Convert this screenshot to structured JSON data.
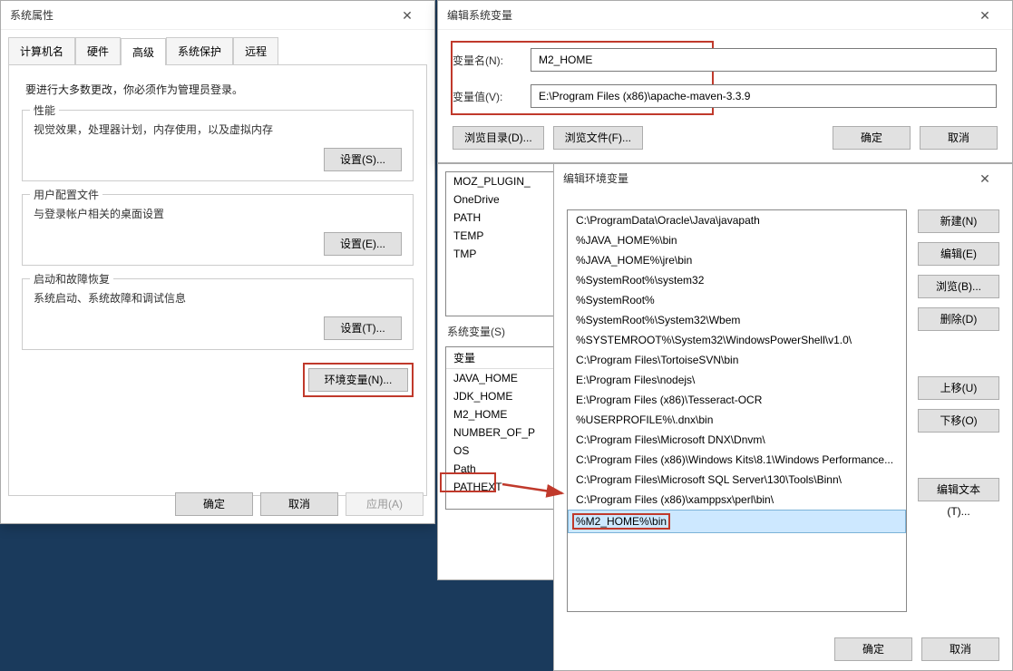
{
  "sysprops": {
    "title": "系统属性",
    "tabs": [
      "计算机名",
      "硬件",
      "高级",
      "系统保护",
      "远程"
    ],
    "active_tab_idx": 2,
    "notice": "要进行大多数更改，你必须作为管理员登录。",
    "group_perf": {
      "legend": "性能",
      "desc": "视觉效果，处理器计划，内存使用，以及虚拟内存",
      "btn": "设置(S)..."
    },
    "group_user": {
      "legend": "用户配置文件",
      "desc": "与登录帐户相关的桌面设置",
      "btn": "设置(E)..."
    },
    "group_start": {
      "legend": "启动和故障恢复",
      "desc": "系统启动、系统故障和调试信息",
      "btn": "设置(T)..."
    },
    "env_btn": "环境变量(N)...",
    "ok": "确定",
    "cancel": "取消",
    "apply": "应用(A)"
  },
  "editvar": {
    "title": "编辑系统变量",
    "name_label": "变量名(N):",
    "value_label": "变量值(V):",
    "name": "M2_HOME",
    "value": "E:\\Program Files (x86)\\apache-maven-3.3.9",
    "browse_dir": "浏览目录(D)...",
    "browse_file": "浏览文件(F)...",
    "ok": "确定",
    "cancel": "取消"
  },
  "envvars": {
    "user_vars": [
      "MOZ_PLUGIN_",
      "OneDrive",
      "PATH",
      "TEMP",
      "TMP"
    ],
    "sys_label": "系统变量(S)",
    "sys_header": "变量",
    "sys_vars": [
      "JAVA_HOME",
      "JDK_HOME",
      "M2_HOME",
      "NUMBER_OF_P",
      "OS",
      "Path",
      "PATHEXT"
    ]
  },
  "editpath": {
    "title": "编辑环境变量",
    "entries": [
      "C:\\ProgramData\\Oracle\\Java\\javapath",
      "%JAVA_HOME%\\bin",
      "%JAVA_HOME%\\jre\\bin",
      "%SystemRoot%\\system32",
      "%SystemRoot%",
      "%SystemRoot%\\System32\\Wbem",
      "%SYSTEMROOT%\\System32\\WindowsPowerShell\\v1.0\\",
      "C:\\Program Files\\TortoiseSVN\\bin",
      "E:\\Program Files\\nodejs\\",
      "E:\\Program Files (x86)\\Tesseract-OCR",
      "%USERPROFILE%\\.dnx\\bin",
      "C:\\Program Files\\Microsoft DNX\\Dnvm\\",
      "C:\\Program Files (x86)\\Windows Kits\\8.1\\Windows Performance...",
      "C:\\Program Files\\Microsoft SQL Server\\130\\Tools\\Binn\\",
      "C:\\Program Files (x86)\\xamppsx\\perl\\bin\\",
      "%M2_HOME%\\bin"
    ],
    "selected_idx": 15,
    "btns": {
      "new": "新建(N)",
      "edit": "编辑(E)",
      "browse": "浏览(B)...",
      "delete": "删除(D)",
      "up": "上移(U)",
      "down": "下移(O)",
      "edittext": "编辑文本(T)..."
    },
    "ok": "确定",
    "cancel": "取消"
  }
}
